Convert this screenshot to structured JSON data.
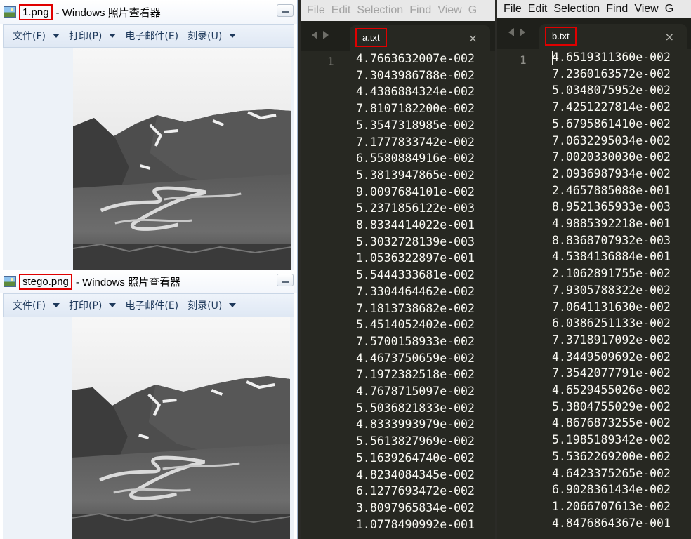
{
  "viewers": [
    {
      "filename": "1.png",
      "title_suffix": "- Windows 照片查看器",
      "menu": [
        {
          "label": "文件(F)"
        },
        {
          "label": "打印(P)"
        },
        {
          "label": "电子邮件(E)"
        },
        {
          "label": "刻录(U)"
        }
      ]
    },
    {
      "filename": "stego.png",
      "title_suffix": "- Windows 照片查看器",
      "menu": [
        {
          "label": "文件(F)"
        },
        {
          "label": "打印(P)"
        },
        {
          "label": "电子邮件(E)"
        },
        {
          "label": "刻录(U)"
        }
      ]
    }
  ],
  "editors": [
    {
      "menu": [
        "File",
        "Edit",
        "Selection",
        "Find",
        "View",
        "G"
      ],
      "tab_label": "a.txt",
      "tab_close": "×",
      "line_number": "1",
      "values": [
        "4.7663632007e-002",
        "7.3043986788e-002",
        "4.4386884324e-002",
        "7.8107182200e-002",
        "5.3547318985e-002",
        "7.1777833742e-002",
        "6.5580884916e-002",
        "5.3813947865e-002",
        "9.0097684101e-002",
        "5.2371856122e-003",
        "8.8334414022e-001",
        "5.3032728139e-003",
        "1.0536322897e-001",
        "5.5444333681e-002",
        "7.3304464462e-002",
        "7.1813738682e-002",
        "5.4514052402e-002",
        "7.5700158933e-002",
        "4.4673750659e-002",
        "7.1972382518e-002",
        "4.7678715097e-002",
        "5.5036821833e-002",
        "4.8333993979e-002",
        "5.5613827969e-002",
        "5.1639264740e-002",
        "4.8234084345e-002",
        "6.1277693472e-002",
        "3.8097965834e-002",
        "1.0778490992e-001"
      ]
    },
    {
      "menu": [
        "File",
        "Edit",
        "Selection",
        "Find",
        "View",
        "G"
      ],
      "tab_label": "b.txt",
      "tab_close": "×",
      "line_number": "1",
      "values": [
        "4.6519311360e-002",
        "7.2360163572e-002",
        "5.0348075952e-002",
        "7.4251227814e-002",
        "5.6795861410e-002",
        "7.0632295034e-002",
        "7.0020330030e-002",
        "2.0936987934e-002",
        "2.4657885088e-001",
        "8.9521365933e-003",
        "4.9885392218e-001",
        "8.8368707932e-003",
        "4.5384136884e-001",
        "2.1062891755e-002",
        "7.9305788322e-002",
        "7.0641131630e-002",
        "6.0386251133e-002",
        "7.3718917092e-002",
        "4.3449509692e-002",
        "7.3542077791e-002",
        "4.6529455026e-002",
        "5.3804755029e-002",
        "4.8676873255e-002",
        "5.1985189342e-002",
        "5.5362269200e-002",
        "4.6423375265e-002",
        "6.9028361434e-002",
        "1.2066707613e-002",
        "4.8476864367e-001"
      ]
    }
  ]
}
